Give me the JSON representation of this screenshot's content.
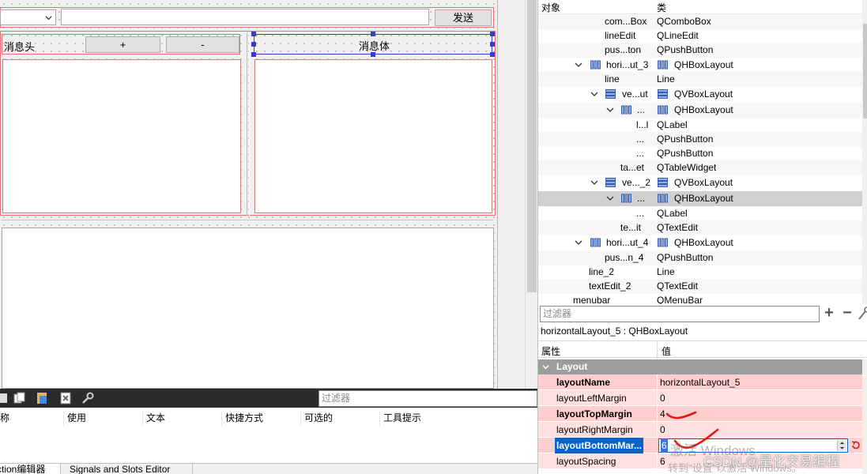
{
  "form": {
    "send_label": "发送",
    "header_label": "消息头",
    "plus_label": "+",
    "minus_label": "-",
    "body_label": "消息体"
  },
  "action_editor": {
    "filter_placeholder": "过滤器",
    "columns": [
      "称",
      "使用",
      "文本",
      "快捷方式",
      "可选的",
      "工具提示"
    ],
    "tabs": [
      "ction编辑器",
      "Signals and Slots Editor"
    ]
  },
  "object_inspector": {
    "col_object": "对象",
    "col_class": "类",
    "rows": [
      {
        "name": "com...Box",
        "cls": "QComboBox"
      },
      {
        "name": "lineEdit",
        "cls": "QLineEdit"
      },
      {
        "name": "pus...ton",
        "cls": "QPushButton"
      },
      {
        "name": "hori...ut_3",
        "cls": "QHBoxLayout"
      },
      {
        "name": "line",
        "cls": "Line"
      },
      {
        "name": "ve...ut",
        "cls": "QVBoxLayout"
      },
      {
        "name": "...",
        "cls": "QHBoxLayout"
      },
      {
        "name": "l...l",
        "cls": "QLabel"
      },
      {
        "name": "...",
        "cls": "QPushButton"
      },
      {
        "name": "...",
        "cls": "QPushButton"
      },
      {
        "name": "ta...et",
        "cls": "QTableWidget"
      },
      {
        "name": "ve..._2",
        "cls": "QVBoxLayout"
      },
      {
        "name": "...",
        "cls": "QHBoxLayout"
      },
      {
        "name": "...",
        "cls": "QLabel"
      },
      {
        "name": "te...it",
        "cls": "QTextEdit"
      },
      {
        "name": "hori...ut_4",
        "cls": "QHBoxLayout"
      },
      {
        "name": "pus...n_4",
        "cls": "QPushButton"
      },
      {
        "name": "line_2",
        "cls": "Line"
      },
      {
        "name": "textEdit_2",
        "cls": "QTextEdit"
      },
      {
        "name": "menubar",
        "cls": "QMenuBar"
      }
    ]
  },
  "property_editor": {
    "filter_placeholder": "过滤器",
    "object_line": "horizontalLayout_5 : QHBoxLayout",
    "col_property": "属性",
    "col_value": "值",
    "group": "Layout",
    "rows": [
      {
        "name": "layoutName",
        "value": "horizontalLayout_5"
      },
      {
        "name": "layoutLeftMargin",
        "value": "0"
      },
      {
        "name": "layoutTopMargin",
        "value": "4"
      },
      {
        "name": "layoutRightMargin",
        "value": "0"
      },
      {
        "name": "layoutBottomMar...",
        "value": "6"
      },
      {
        "name": "layoutSpacing",
        "value": "6"
      }
    ]
  },
  "overlay": {
    "activate_line1": "激活 Windows",
    "activate_line2": "转到\"设置\"以激活 Windows。",
    "csdn": "CSDN @量化交易编程"
  }
}
